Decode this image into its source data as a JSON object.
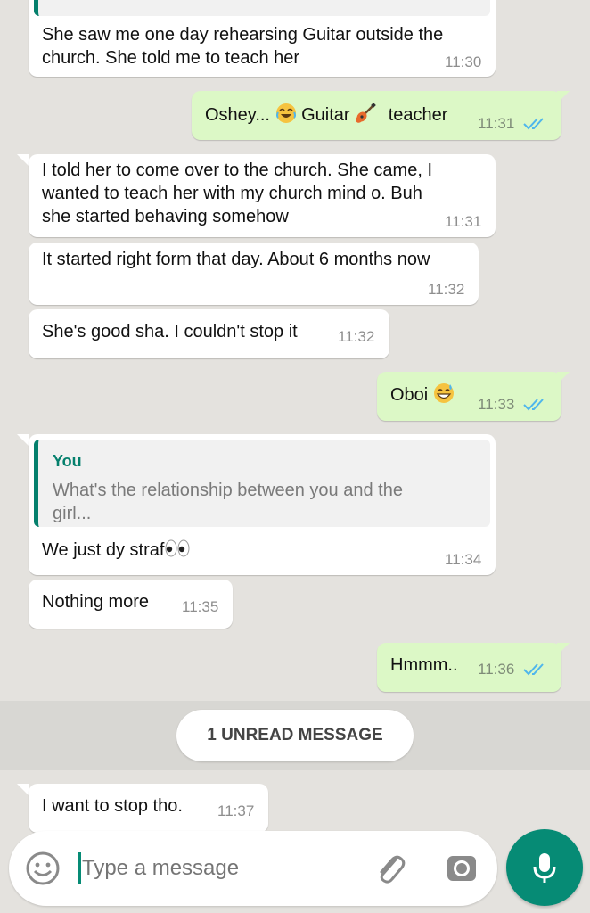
{
  "messages": [
    {
      "dir": "in",
      "text_lines": [
        "She saw me one day rehearsing Guitar outside the",
        "church. She told me to teach her"
      ],
      "time": "11:30"
    },
    {
      "dir": "out",
      "parts": [
        "Oshey...",
        "Guitar",
        "teacher"
      ],
      "emojis": [
        "tears-of-joy-emoji",
        "guitar-emoji"
      ],
      "time": "11:31",
      "status": "read"
    },
    {
      "dir": "in",
      "text_lines": [
        "I told her to come over to the church. She came, I",
        "wanted to teach her with my church mind o. Buh",
        "she started behaving somehow"
      ],
      "time": "11:31"
    },
    {
      "dir": "in",
      "text": "It started right form that day. About 6 months now",
      "time": "11:32"
    },
    {
      "dir": "in",
      "text": "She's good sha. I couldn't stop it",
      "time": "11:32"
    },
    {
      "dir": "out",
      "text": "Oboi",
      "emoji": "grinning-sweat-emoji",
      "time": "11:33",
      "status": "read"
    },
    {
      "dir": "in",
      "quote": {
        "author": "You",
        "text_lines": [
          "What's the relationship between you and the",
          "girl..."
        ]
      },
      "text": "We just dy straf",
      "emoji": "eyes-emoji",
      "time": "11:34"
    },
    {
      "dir": "in",
      "text": "Nothing more",
      "time": "11:35"
    },
    {
      "dir": "out",
      "text": "Hmmm..",
      "time": "11:36",
      "status": "read"
    },
    {
      "dir": "in",
      "text": "I want to stop tho.",
      "time": "11:37"
    }
  ],
  "unread_banner": "1 UNREAD MESSAGE",
  "composer": {
    "placeholder": "Type a message",
    "emoji_icon": "smiley-icon",
    "attach_icon": "paperclip-icon",
    "camera_icon": "camera-icon",
    "mic_icon": "microphone-icon"
  },
  "colors": {
    "background": "#e4e2de",
    "incoming": "#ffffff",
    "outgoing": "#dcf8c6",
    "accent": "#068b75",
    "read_ticks": "#4fb6ec",
    "quote_author": "#05806d"
  }
}
